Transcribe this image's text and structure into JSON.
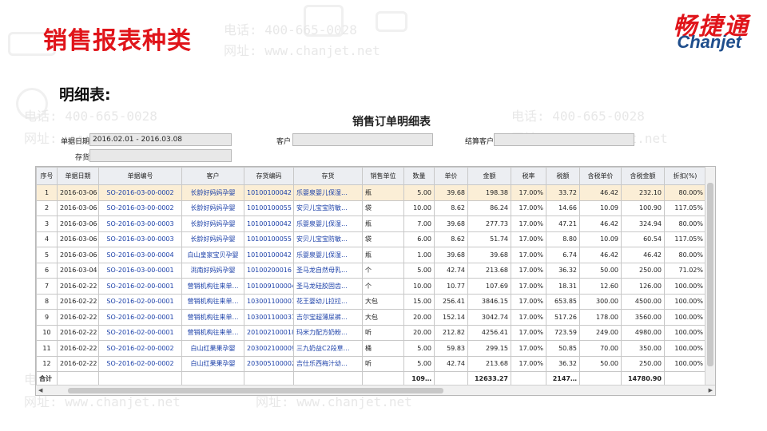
{
  "header": {
    "title": "销售报表种类",
    "logo_cn": "畅捷通",
    "logo_en": "Chanjet",
    "subtitle": "明细表:"
  },
  "watermark": {
    "phone": "电话: 400-665-0028",
    "site": "网址: www.chanjet.net"
  },
  "report": {
    "title": "销售订单明细表",
    "filters": {
      "date_label": "单据日期",
      "date_value": "2016.02.01 - 2016.03.08",
      "customer_label": "客户",
      "customer_value": "",
      "settle_label": "结算客户",
      "settle_value": "",
      "inventory_label": "存货",
      "inventory_value": ""
    },
    "columns": [
      "序号",
      "单据日期",
      "单据编号",
      "客户",
      "存货编码",
      "存货",
      "销售单位",
      "数量",
      "单价",
      "金额",
      "税率",
      "税额",
      "含税单价",
      "含税金额",
      "折扣(%)"
    ],
    "rows": [
      [
        "1",
        "2016-03-06",
        "SO-2016-03-00-0002",
        "长龄好妈妈孕婴",
        "10100100042",
        "乐婴泉婴儿保湿…",
        "瓶",
        "5.00",
        "39.68",
        "198.38",
        "17.00%",
        "33.72",
        "46.42",
        "232.10",
        "80.00%"
      ],
      [
        "2",
        "2016-03-06",
        "SO-2016-03-00-0002",
        "长龄好妈妈孕婴",
        "10100100055",
        "安贝儿宝宝防敏…",
        "袋",
        "10.00",
        "8.62",
        "86.24",
        "17.00%",
        "14.66",
        "10.09",
        "100.90",
        "117.05%"
      ],
      [
        "3",
        "2016-03-06",
        "SO-2016-03-00-0003",
        "长龄好妈妈孕婴",
        "10100100042",
        "乐婴泉婴儿保湿…",
        "瓶",
        "7.00",
        "39.68",
        "277.73",
        "17.00%",
        "47.21",
        "46.42",
        "324.94",
        "80.00%"
      ],
      [
        "4",
        "2016-03-06",
        "SO-2016-03-00-0003",
        "长龄好妈妈孕婴",
        "10100100055",
        "安贝儿宝宝防敏…",
        "袋",
        "6.00",
        "8.62",
        "51.74",
        "17.00%",
        "8.80",
        "10.09",
        "60.54",
        "117.05%"
      ],
      [
        "5",
        "2016-03-06",
        "SO-2016-03-00-0004",
        "白山皇家宝贝孕婴",
        "10100100042",
        "乐婴泉婴儿保湿…",
        "瓶",
        "1.00",
        "39.68",
        "39.68",
        "17.00%",
        "6.74",
        "46.42",
        "46.42",
        "80.00%"
      ],
      [
        "6",
        "2016-03-04",
        "SO-2016-03-00-0001",
        "洮南好妈妈孕婴",
        "10100200016",
        "圣马龙自然母乳…",
        "个",
        "5.00",
        "42.74",
        "213.68",
        "17.00%",
        "36.32",
        "50.00",
        "250.00",
        "71.02%"
      ],
      [
        "7",
        "2016-02-22",
        "SO-2016-02-00-0001",
        "营销机构往来单…",
        "101009100004",
        "圣马龙硅胶固齿…",
        "个",
        "10.00",
        "10.77",
        "107.69",
        "17.00%",
        "18.31",
        "12.60",
        "126.00",
        "100.00%"
      ],
      [
        "8",
        "2016-02-22",
        "SO-2016-02-00-0001",
        "营销机构往来单…",
        "103001100001",
        "花王婴幼儿拉拉…",
        "大包",
        "15.00",
        "256.41",
        "3846.15",
        "17.00%",
        "653.85",
        "300.00",
        "4500.00",
        "100.00%"
      ],
      [
        "9",
        "2016-02-22",
        "SO-2016-02-00-0001",
        "营销机构往来单…",
        "103001100031",
        "吉尔宝超薄尿裤…",
        "大包",
        "20.00",
        "152.14",
        "3042.74",
        "17.00%",
        "517.26",
        "178.00",
        "3560.00",
        "100.00%"
      ],
      [
        "10",
        "2016-02-22",
        "SO-2016-02-00-0001",
        "营销机构往来单…",
        "201002100018",
        "玛米力配方奶粉…",
        "听",
        "20.00",
        "212.82",
        "4256.41",
        "17.00%",
        "723.59",
        "249.00",
        "4980.00",
        "100.00%"
      ],
      [
        "11",
        "2016-02-22",
        "SO-2016-02-00-0002",
        "白山红果果孕婴",
        "203002100009",
        "三九奶益C2段草…",
        "桶",
        "5.00",
        "59.83",
        "299.15",
        "17.00%",
        "50.85",
        "70.00",
        "350.00",
        "100.00%"
      ],
      [
        "12",
        "2016-02-22",
        "SO-2016-02-00-0002",
        "白山红果果孕婴",
        "203005100002",
        "吉仕乐西梅汁幼…",
        "听",
        "5.00",
        "42.74",
        "213.68",
        "17.00%",
        "36.32",
        "50.00",
        "250.00",
        "100.00%"
      ]
    ],
    "total": {
      "label": "合计",
      "qty": "109…",
      "amount": "12633.27",
      "tax": "2147…",
      "amount_with_tax": "14780.90"
    }
  }
}
